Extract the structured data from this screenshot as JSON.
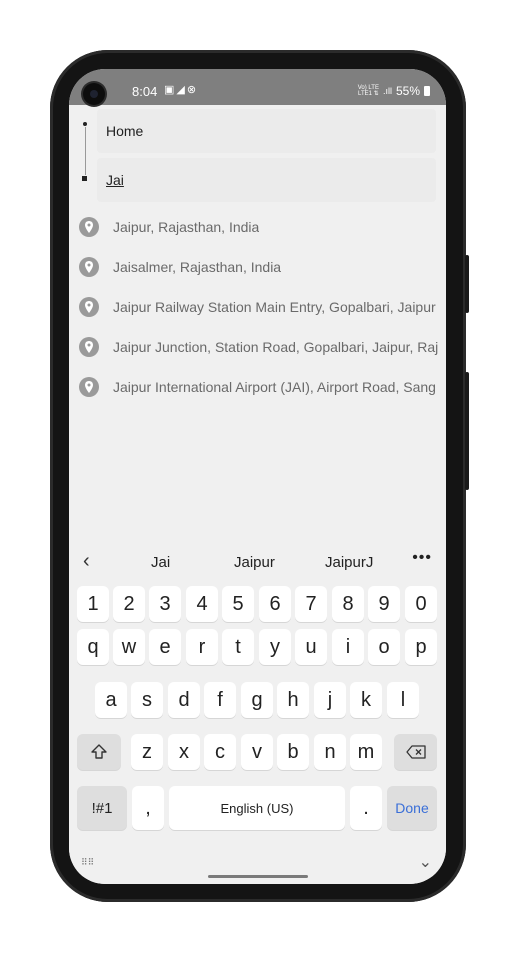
{
  "status_bar": {
    "time": "8:04",
    "notification_icons": [
      "image-icon",
      "telegram-icon",
      "app-icon"
    ],
    "network_label_top": "Vo) LTE",
    "network_label_bottom": "LTE1 ⇅",
    "battery": "55%"
  },
  "route": {
    "from_value": "Home",
    "to_value": "Jai"
  },
  "suggestions": [
    "Jaipur, Rajasthan, India",
    "Jaisalmer, Rajasthan, India",
    "Jaipur Railway Station Main Entry, Gopalbari, Jaipur",
    "Jaipur Junction, Station Road, Gopalbari, Jaipur, Raj",
    "Jaipur International Airport (JAI), Airport Road, Sang"
  ],
  "keyboard": {
    "predictions": [
      "Jai",
      "Jaipur",
      "JaipurJ"
    ],
    "more_label": "•••",
    "rows": {
      "numbers": [
        "1",
        "2",
        "3",
        "4",
        "5",
        "6",
        "7",
        "8",
        "9",
        "0"
      ],
      "row1": [
        "q",
        "w",
        "e",
        "r",
        "t",
        "y",
        "u",
        "i",
        "o",
        "p"
      ],
      "row2": [
        "a",
        "s",
        "d",
        "f",
        "g",
        "h",
        "j",
        "k",
        "l"
      ],
      "row3": [
        "z",
        "x",
        "c",
        "v",
        "b",
        "n",
        "m"
      ]
    },
    "symbols_label": "!#1",
    "comma_label": ",",
    "space_label": "English (US)",
    "period_label": ".",
    "done_label": "Done",
    "colors": {
      "done": "#3a6fd8",
      "key": "#ffffff",
      "special_key": "#dedede"
    }
  }
}
